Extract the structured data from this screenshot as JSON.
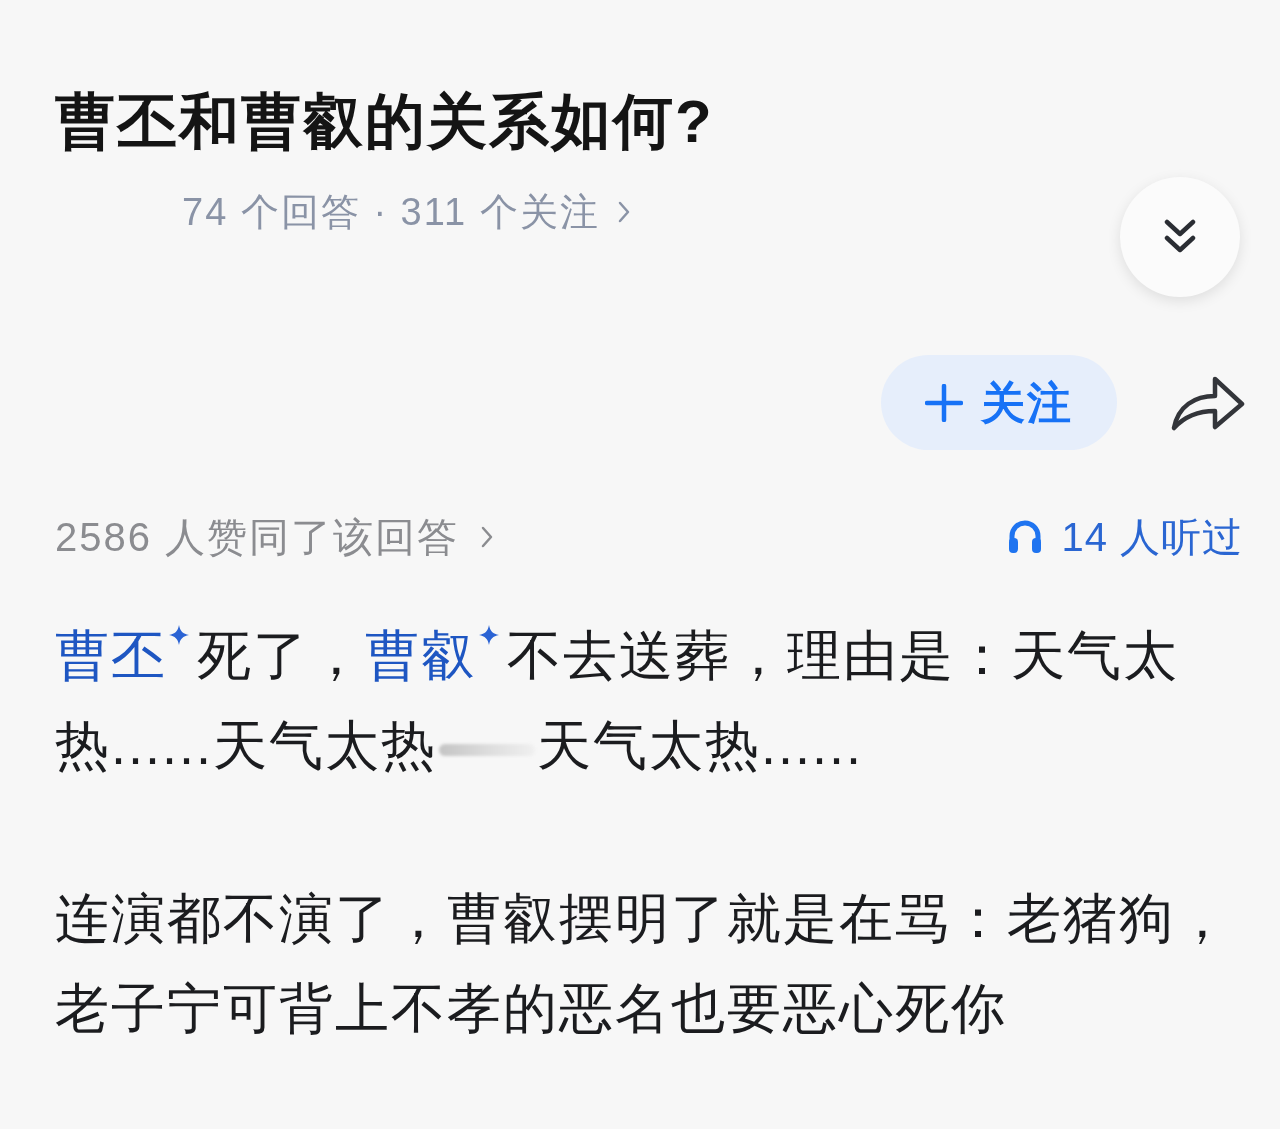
{
  "question": {
    "title": "曹丕和曹叡的关系如何?",
    "stats": "74 个回答 · 311 个关注"
  },
  "follow_button": {
    "label": "关注"
  },
  "answer": {
    "upvotes": "2586 人赞同了该回答",
    "listens": "14 人听过",
    "paragraphs": [
      {
        "segments": [
          {
            "kind": "link",
            "text": "曹丕"
          },
          {
            "kind": "text",
            "text": "死了，"
          },
          {
            "kind": "link",
            "text": "曹叡"
          },
          {
            "kind": "text",
            "text": "不去送葬，理由是：天气太热......天气太热"
          },
          {
            "kind": "smudge"
          },
          {
            "kind": "text",
            "text": "天气太热......"
          }
        ]
      },
      {
        "segments": [
          {
            "kind": "text",
            "text": "连演都不演了，曹叡摆明了就是在骂：老猪狗，老子宁可背上不孝的恶名也要恶心死你"
          }
        ]
      }
    ]
  }
}
